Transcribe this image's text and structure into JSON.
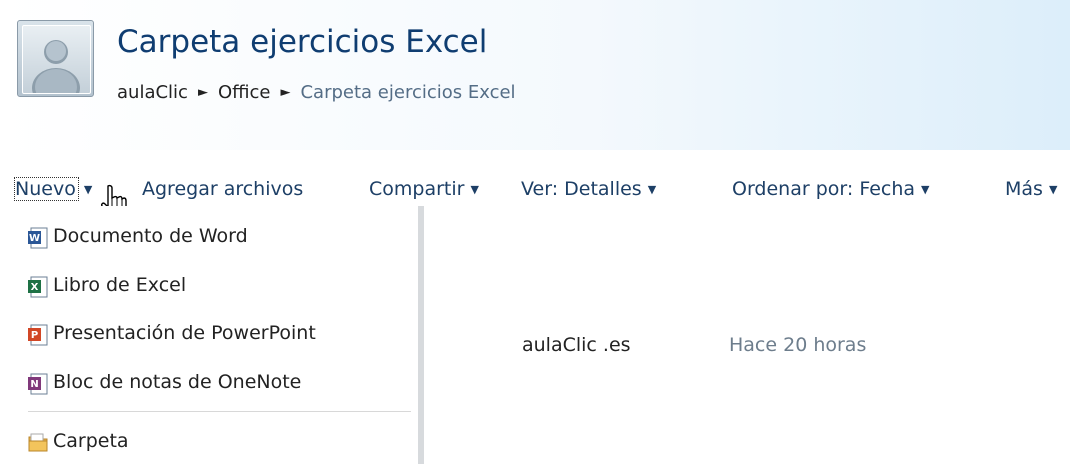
{
  "header": {
    "title": "Carpeta ejercicios Excel",
    "breadcrumb": {
      "items": [
        "aulaClic",
        "Office"
      ],
      "separator": "►",
      "current": "Carpeta ejercicios Excel"
    }
  },
  "toolbar": {
    "nuevo": "Nuevo",
    "agregar": "Agregar archivos",
    "compartir": "Compartir",
    "ver": "Ver: Detalles",
    "ordenar": "Ordenar por: Fecha",
    "mas": "Más",
    "caret": "▼"
  },
  "menu": {
    "items": [
      {
        "label": "Documento de Word",
        "icon": "word-doc-icon",
        "color": "#2b5797"
      },
      {
        "label": "Libro de Excel",
        "icon": "excel-book-icon",
        "color": "#1e7145"
      },
      {
        "label": "Presentación de PowerPoint",
        "icon": "powerpoint-icon",
        "color": "#d24726"
      },
      {
        "label": "Bloc de notas de OneNote",
        "icon": "onenote-icon",
        "color": "#80397b"
      },
      {
        "label": "Carpeta",
        "icon": "folder-icon",
        "color": "#e8b04a"
      }
    ]
  },
  "file_row": {
    "author": "aulaClic .es",
    "modified": "Hace 20 horas"
  }
}
